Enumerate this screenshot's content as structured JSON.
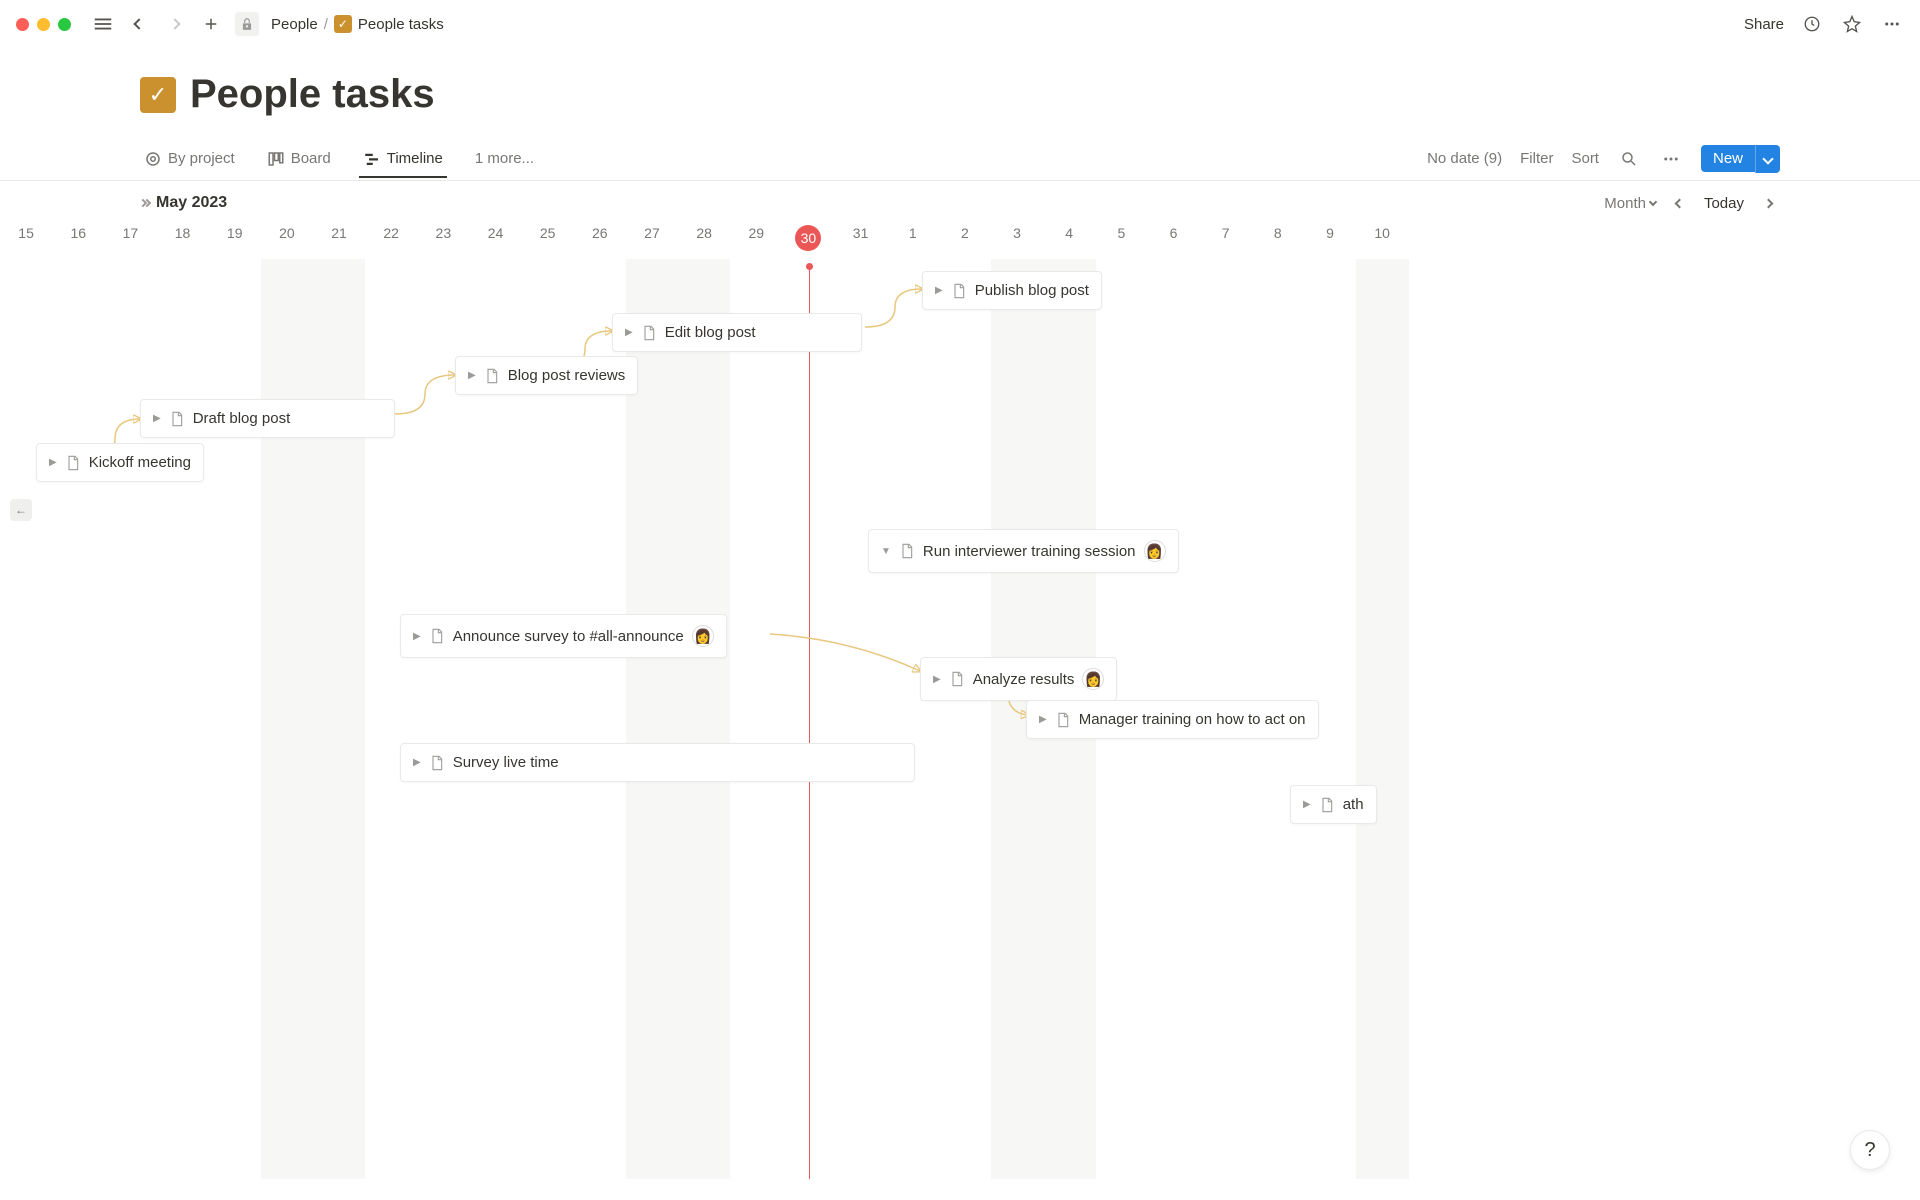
{
  "titlebar": {
    "breadcrumb_parent": "People",
    "breadcrumb_sep": "/",
    "breadcrumb_current": "People tasks",
    "share": "Share"
  },
  "page": {
    "title": "People tasks"
  },
  "views": {
    "by_project": "By project",
    "board": "Board",
    "timeline": "Timeline",
    "more": "1 more...",
    "no_date": "No date (9)",
    "filter": "Filter",
    "sort": "Sort",
    "new": "New"
  },
  "timeline": {
    "month_label": "May 2023",
    "scale": "Month",
    "today": "Today",
    "today_index": 15,
    "dates": [
      "15",
      "16",
      "17",
      "18",
      "19",
      "20",
      "21",
      "22",
      "23",
      "24",
      "25",
      "26",
      "27",
      "28",
      "29",
      "30",
      "31",
      "1",
      "2",
      "3",
      "4",
      "5",
      "6",
      "7",
      "8",
      "9",
      "10"
    ],
    "weekend_indices": [
      5,
      6,
      12,
      13,
      19,
      20,
      26
    ]
  },
  "tasks": {
    "kickoff": "Kickoff meeting",
    "draft": "Draft blog post",
    "reviews": "Blog post reviews",
    "edit": "Edit blog post",
    "publish": "Publish blog post",
    "interviewer": "Run interviewer training session",
    "announce": "Announce survey to #all-announce",
    "analyze": "Analyze results",
    "manager": "Manager training on how to act on",
    "survey": "Survey live time",
    "ath": "ath"
  },
  "help": "?"
}
